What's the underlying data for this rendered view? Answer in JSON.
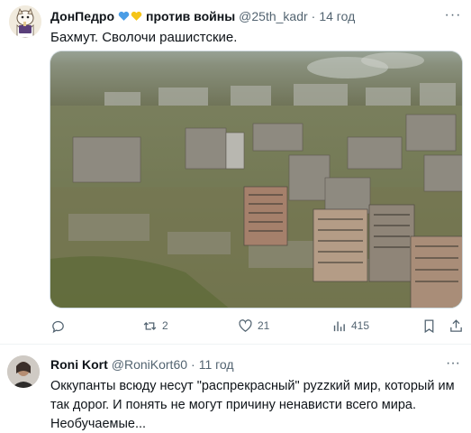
{
  "tweet": {
    "author_name": "ДонПедро",
    "author_name_suffix": "против войны",
    "handle": "@25th_kadr",
    "separator": "·",
    "time": "14 год",
    "text": "Бахмут. Сволочи рашистские.",
    "more": "···",
    "colors": {
      "heart_blue": "#4a9de6",
      "heart_yellow": "#f5c518"
    },
    "stats": {
      "replies": "",
      "retweets": "2",
      "likes": "21",
      "views": "415"
    }
  },
  "reply": {
    "author_name": "Roni Kort",
    "handle": "@RoniKort60",
    "separator": "·",
    "time": "11 год",
    "more": "···",
    "text": "Оккупанты всюду несут \"распрекрасный\" руzzкий мир, который им так дорог. И понять не могут причину ненависти всего мира. Необучаемые..."
  },
  "icons": {
    "reply": "comment-icon",
    "retweet": "retweet-icon",
    "like": "heart-icon",
    "views": "views-icon",
    "bookmark": "bookmark-icon",
    "share": "share-icon"
  }
}
